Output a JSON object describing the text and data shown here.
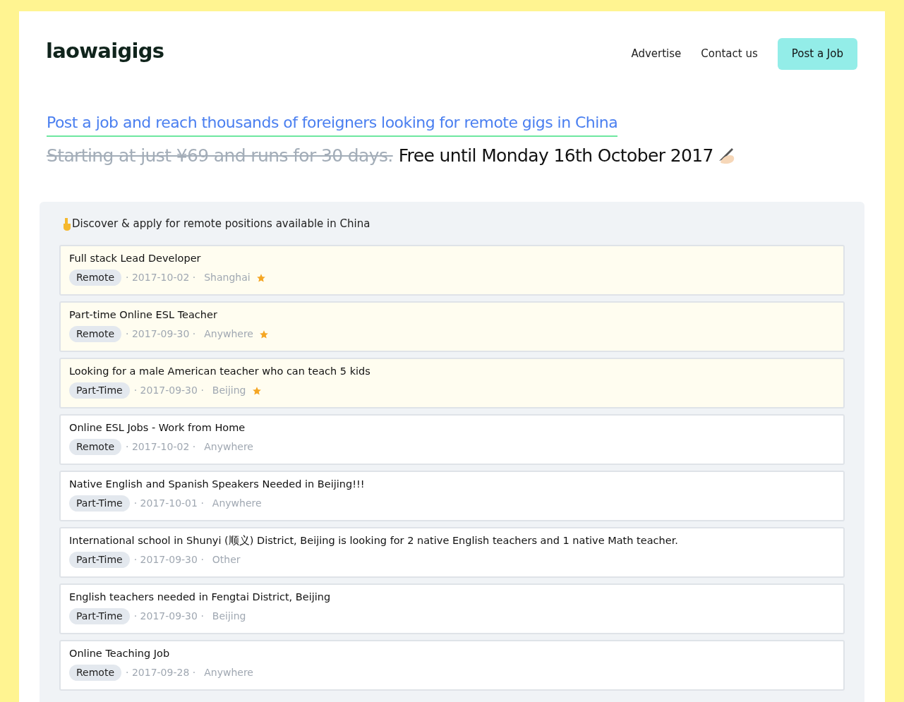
{
  "header": {
    "logo": "laowaigigs",
    "nav": [
      "Advertise",
      "Contact us"
    ],
    "cta": "Post a Job"
  },
  "hero": {
    "headline": "Post a job and reach thousands of foreigners looking for remote gigs in China",
    "old_price": "Starting at just ¥69 and runs for 30 days.",
    "offer": "Free until Monday 16th October 2017"
  },
  "listing": {
    "intro": "Discover & apply for remote positions available in China",
    "jobs": [
      {
        "title": "Full stack Lead Developer",
        "type": "Remote",
        "date": "· 2017-10-02 ·",
        "location": "Shanghai",
        "featured": true
      },
      {
        "title": "Part-time Online ESL Teacher",
        "type": "Remote",
        "date": "· 2017-09-30 ·",
        "location": "Anywhere",
        "featured": true
      },
      {
        "title": "Looking for a male American teacher who can teach 5 kids",
        "type": "Part-Time",
        "date": "· 2017-09-30 ·",
        "location": "Beijing",
        "featured": true
      },
      {
        "title": "Online ESL Jobs - Work from Home",
        "type": "Remote",
        "date": "· 2017-10-02 ·",
        "location": "Anywhere",
        "featured": false
      },
      {
        "title": "Native English and Spanish Speakers Needed in Beijing!!!",
        "type": "Part-Time",
        "date": "· 2017-10-01 ·",
        "location": "Anywhere",
        "featured": false
      },
      {
        "title": "International school in Shunyi (顺义) District, Beijing is looking for 2 native English teachers and 1 native Math teacher.",
        "type": "Part-Time",
        "date": "· 2017-09-30 ·",
        "location": "Other",
        "featured": false
      },
      {
        "title": "English teachers needed in Fengtai District, Beijing",
        "type": "Part-Time",
        "date": "· 2017-09-30 ·",
        "location": "Beijing",
        "featured": false
      },
      {
        "title": "Online Teaching Job",
        "type": "Remote",
        "date": "· 2017-09-28 ·",
        "location": "Anywhere",
        "featured": false
      }
    ]
  }
}
